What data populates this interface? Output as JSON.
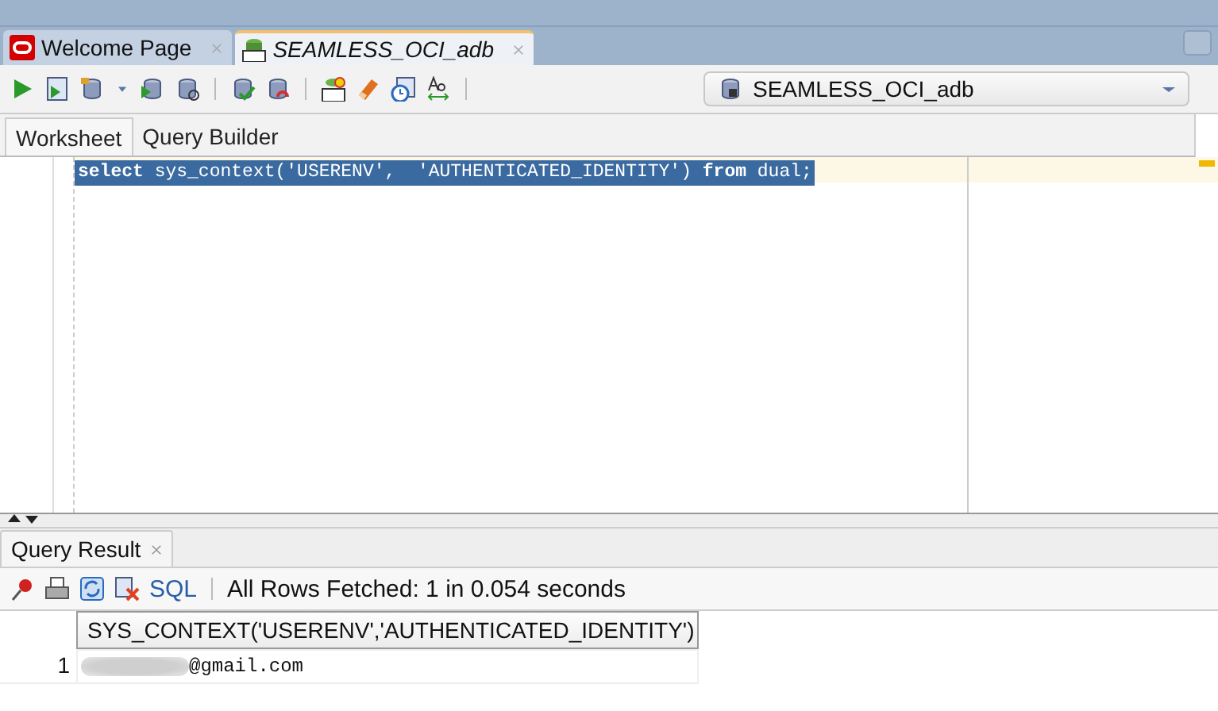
{
  "doc_tabs": [
    {
      "label": "Welcome Page",
      "selected": false,
      "kind": "welcome"
    },
    {
      "label": "SEAMLESS_OCI_adb",
      "selected": true,
      "kind": "sql"
    }
  ],
  "connection": {
    "value": "SEAMLESS_OCI_adb"
  },
  "editor_tabs": [
    {
      "label": "Worksheet",
      "selected": true
    },
    {
      "label": "Query Builder",
      "selected": false
    }
  ],
  "editor": {
    "code": "**select** sys_context('USERENV',  'AUTHENTICATED_IDENTITY') **from** dual;",
    "selected": true
  },
  "result_panel": {
    "tab": "Query Result",
    "sql_link": "SQL",
    "status": "All Rows Fetched: 1 in 0.054 seconds",
    "columns": [
      "SYS_CONTEXT('USERENV','AUTHENTICATED_IDENTITY')"
    ],
    "rows": [
      {
        "number": "1",
        "cells": [
          "@gmail.com"
        ]
      }
    ]
  }
}
